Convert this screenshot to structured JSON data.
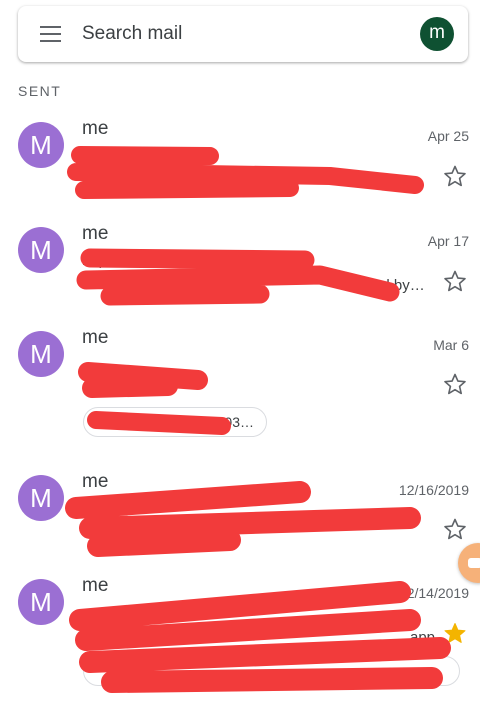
{
  "search": {
    "placeholder": "Search mail",
    "account_initial": "m"
  },
  "section": {
    "label": "SENT"
  },
  "emails": [
    {
      "avatar": "M",
      "sender": "me",
      "date": "Apr 25",
      "line1": "",
      "line2": "…",
      "starred": false
    },
    {
      "avatar": "M",
      "sender": "me",
      "date": "Apr 17",
      "line1": "https://…subscribe…",
      "line2": "…ed by…",
      "starred": false
    },
    {
      "avatar": "M",
      "sender": "me",
      "date": "Mar 6",
      "line1": "",
      "line2": "",
      "attachment": "…03…",
      "starred": false
    },
    {
      "avatar": "M",
      "sender": "me",
      "date": "12/16/2019",
      "line1": "",
      "line2": "",
      "starred": false
    },
    {
      "avatar": "M",
      "sender": "me",
      "date": "12/14/2019",
      "line1": "",
      "line2": "…app…",
      "attachment": "",
      "starred": true
    }
  ],
  "colors": {
    "avatar": "#9b6fd3",
    "account": "#0f5132",
    "star_active": "#f4b400",
    "redaction": "#f23b3b",
    "fab": "#f6b179"
  },
  "icons": {
    "menu": "hamburger-menu-icon",
    "star": "star-outline-icon",
    "star_filled": "star-filled-icon"
  }
}
